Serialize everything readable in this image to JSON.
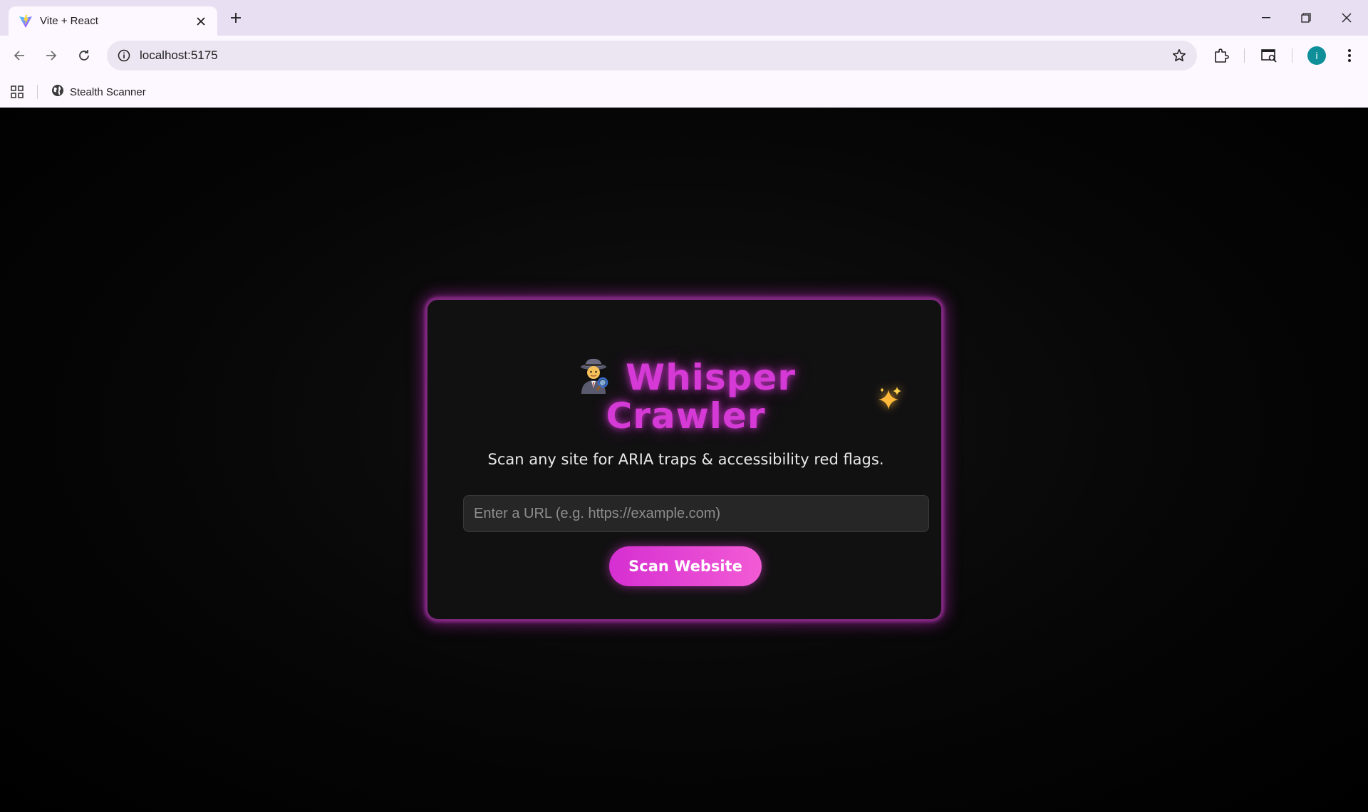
{
  "browser": {
    "tab": {
      "title": "Vite + React",
      "favicon": "vite-logo"
    },
    "new_tab_label": "+",
    "address": "localhost:5175",
    "bookmarks": [
      {
        "label": "Stealth Scanner",
        "icon": "globe-icon"
      }
    ],
    "profile_initial": "i",
    "profile_color": "#0e8f9a"
  },
  "page": {
    "title_emoji": "detective-icon",
    "title_line1": "Whisper",
    "title_line2": "Crawler",
    "sparkle": "sparkles-icon",
    "subtitle": "Scan any site for ARIA traps & accessibility red flags.",
    "url_placeholder": "Enter a URL (e.g. https://example.com)",
    "url_value": "",
    "scan_button": "Scan Website",
    "accent_color": "#d63ad6",
    "background_color": "#000000"
  }
}
